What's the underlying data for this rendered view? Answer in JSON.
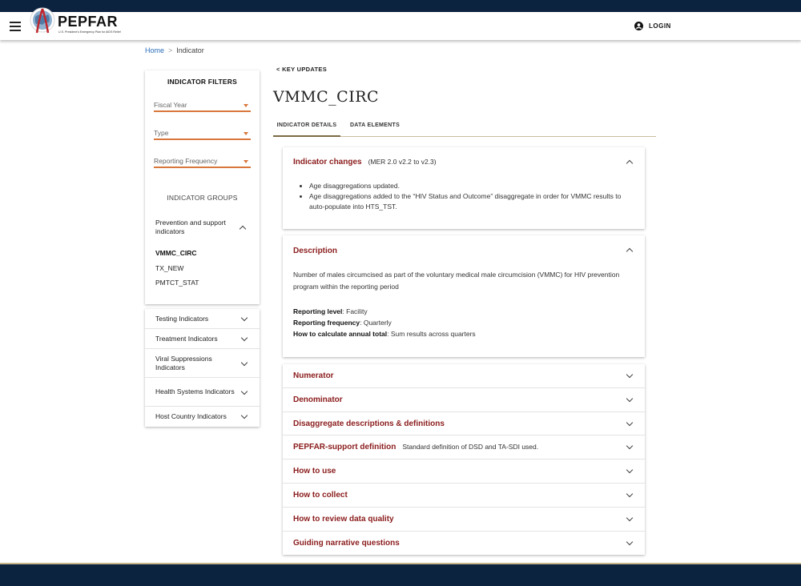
{
  "header": {
    "brand": "PEPFAR",
    "tagline": "U.S. President's Emergency Plan for AIDS Relief",
    "menu_icon": "hamburger-menu-icon",
    "login_label": "LOGIN",
    "login_icon": "account-circle-icon"
  },
  "breadcrumb": {
    "home": "Home",
    "separator": ">",
    "current": "Indicator"
  },
  "filters": {
    "title": "INDICATOR FILTERS",
    "fiscal_year": "Fiscal Year",
    "type": "Type",
    "reporting_frequency": "Reporting Frequency",
    "groups_title": "INDICATOR GROUPS",
    "accent_color": "#d9763b"
  },
  "groups": {
    "open_group": {
      "label": "Prevention and support indicators",
      "items": [
        {
          "label": "VMMC_CIRC",
          "active": true
        },
        {
          "label": "TX_NEW",
          "active": false
        },
        {
          "label": "PMTCT_STAT",
          "active": false
        }
      ]
    },
    "collapsed": [
      "Testing Indicators",
      "Treatment Indicators",
      "Viral Suppressions Indicators",
      "Health Systems Indicators",
      "Host Country Indicators"
    ]
  },
  "main": {
    "back_link": "< KEY UPDATES",
    "title": "VMMC_CIRC",
    "tabs": [
      {
        "label": "INDICATOR DETAILS",
        "active": true
      },
      {
        "label": "DATA ELEMENTS",
        "active": false
      }
    ]
  },
  "indicator_changes": {
    "title": "Indicator changes",
    "subtitle": "(MER 2.0 v2.2 to v2.3)",
    "bullets": [
      "Age disaggregations updated.",
      "Age disaggregations added to the “HIV Status and Outcome” disaggregate in order for VMMC results to auto-populate into HTS_TST."
    ]
  },
  "description": {
    "title": "Description",
    "text": "Number of males circumcised as part of the voluntary medical male circumcision (VMMC) for HIV prevention program within the reporting period",
    "reporting_level_label": "Reporting level",
    "reporting_level_value": ": Facility",
    "reporting_frequency_label": "Reporting frequency",
    "reporting_frequency_value": ": Quarterly",
    "annual_total_label": "How to calculate annual total",
    "annual_total_value": ": Sum results across quarters"
  },
  "accordions": [
    {
      "title": "Numerator",
      "note": ""
    },
    {
      "title": "Denominator",
      "note": ""
    },
    {
      "title": "Disaggregate descriptions & definitions",
      "note": ""
    },
    {
      "title": "PEPFAR-support definition",
      "note": "Standard definition of DSD and TA-SDI used."
    },
    {
      "title": "How to use",
      "note": ""
    },
    {
      "title": "How to collect",
      "note": ""
    },
    {
      "title": "How to review data quality",
      "note": ""
    },
    {
      "title": "Guiding narrative questions",
      "note": ""
    }
  ],
  "colors": {
    "navy": "#0c2340",
    "heading_red": "#8b1c1c",
    "gold": "#c6b48a",
    "link_blue": "#2a6ebb"
  }
}
